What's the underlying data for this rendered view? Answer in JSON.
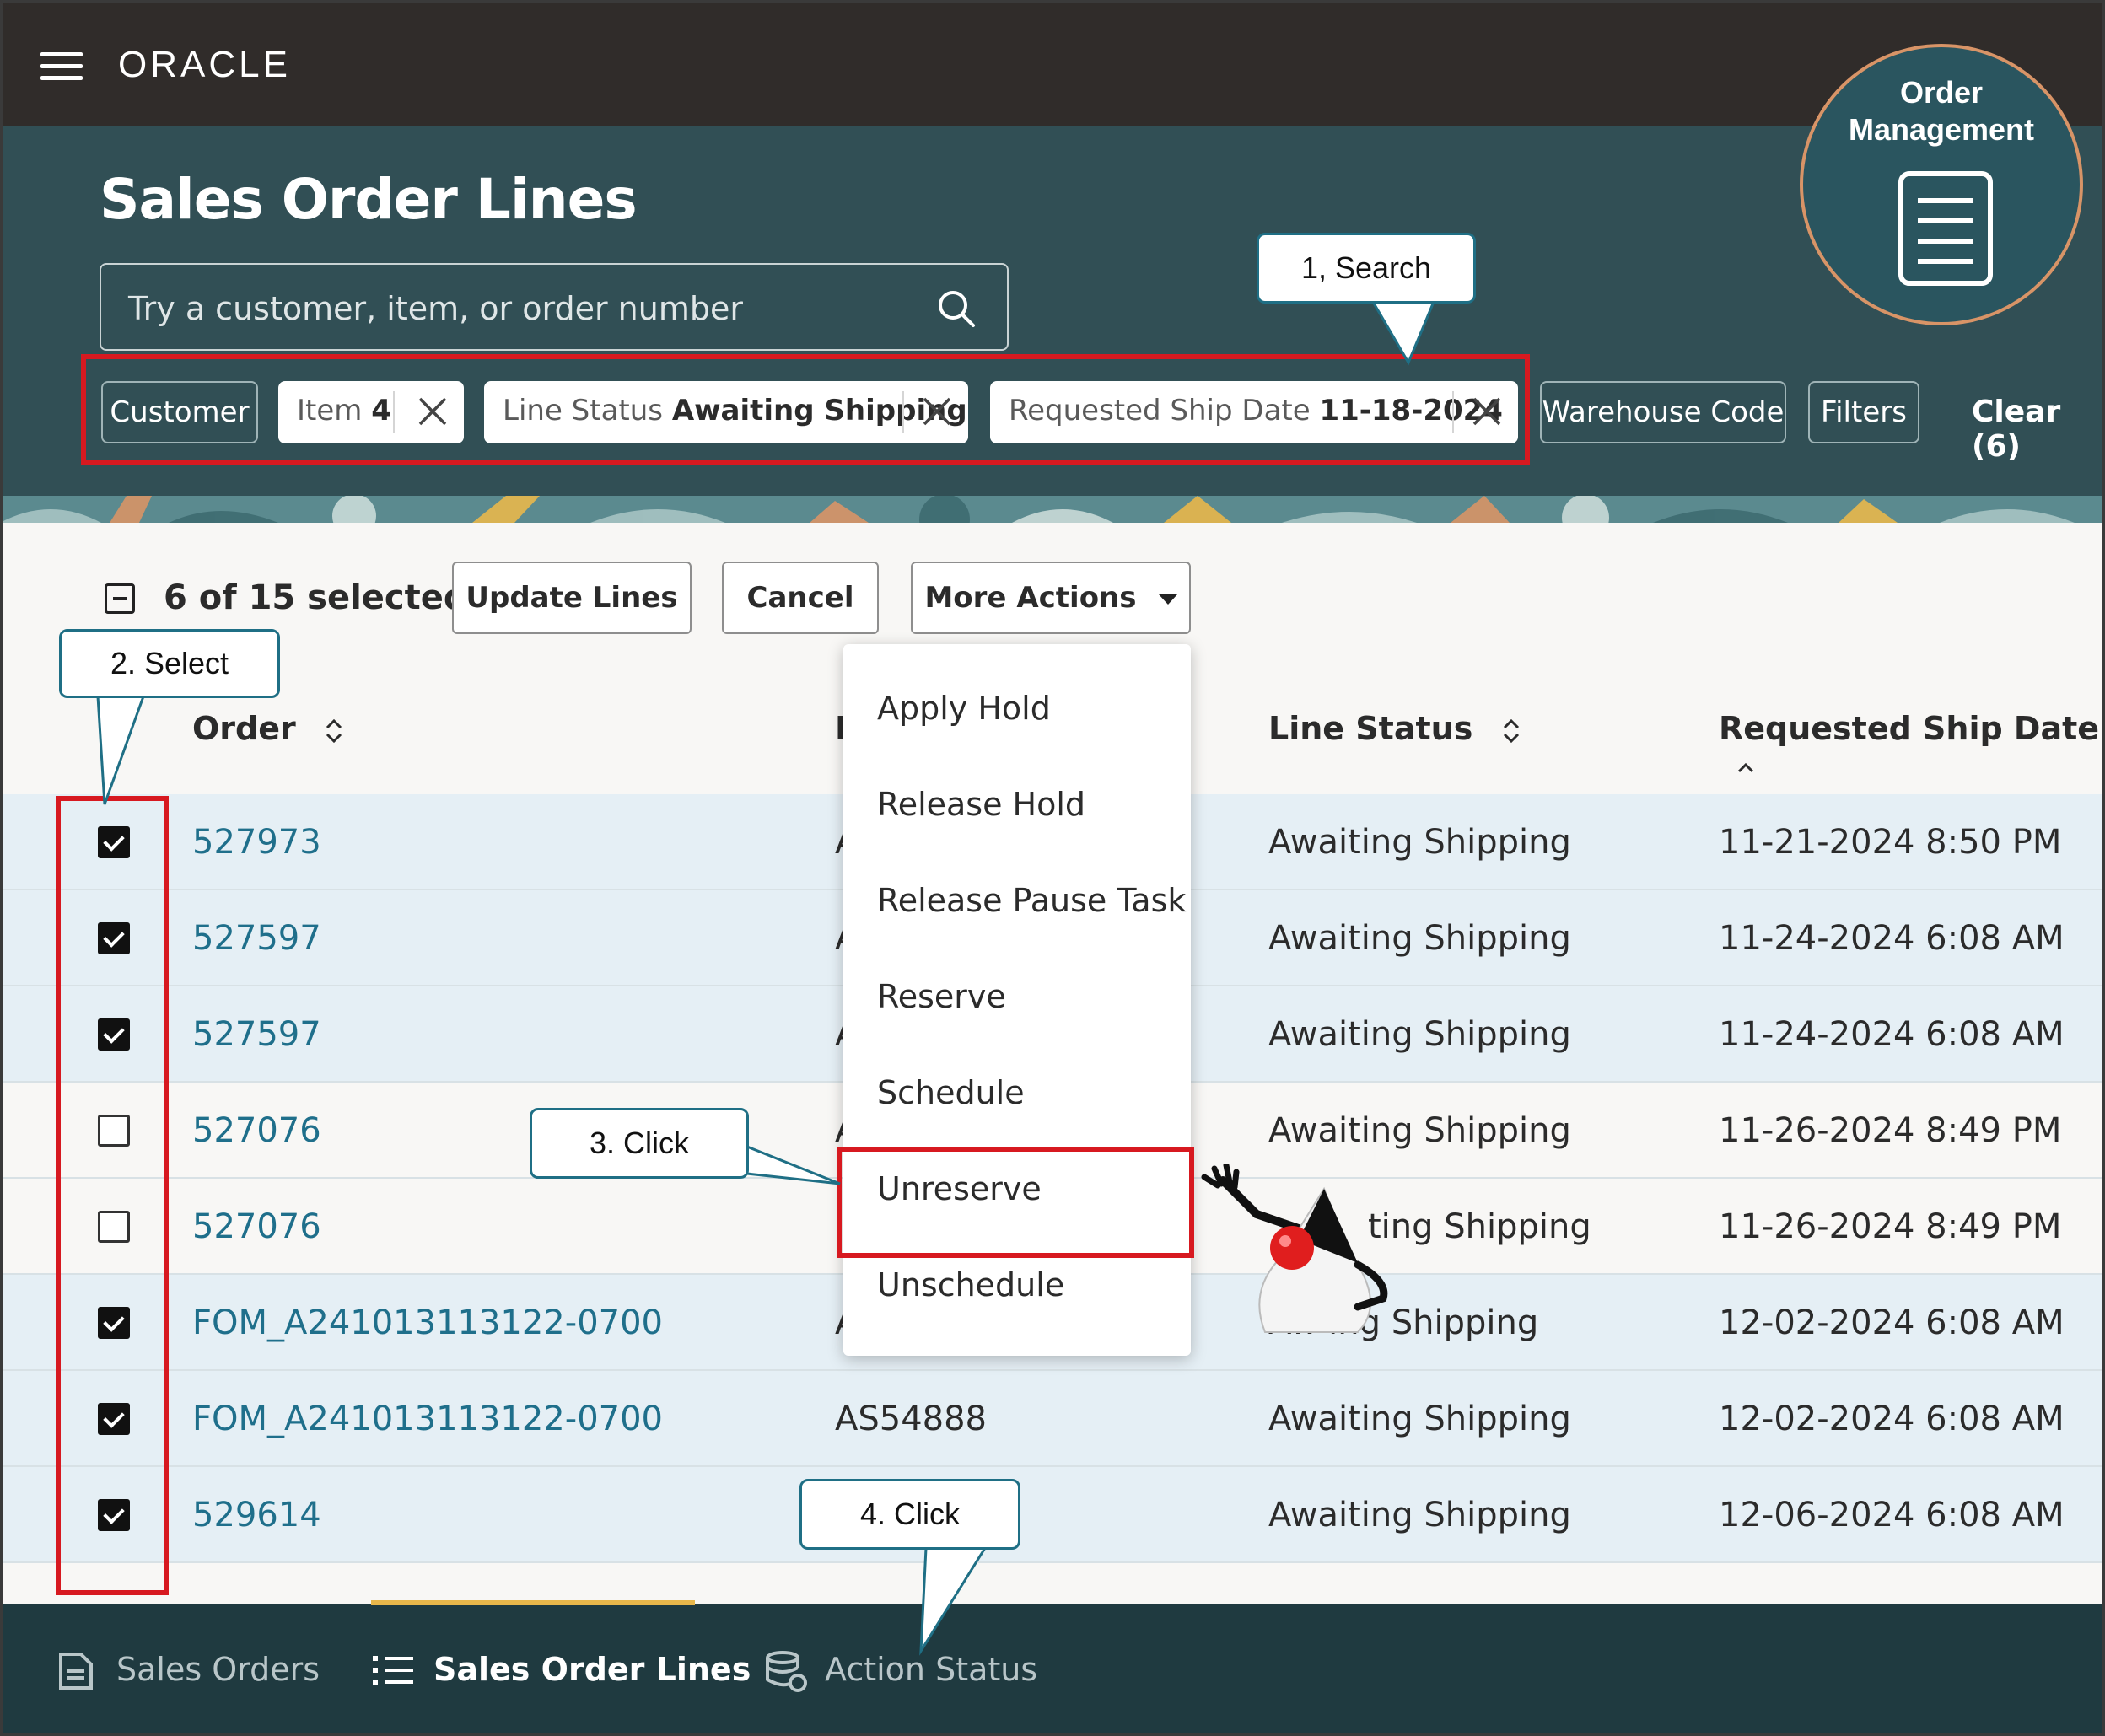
{
  "app": {
    "brand": "ORACLE",
    "badge_line1": "Order",
    "badge_line2": "Management"
  },
  "page": {
    "title": "Sales Order Lines"
  },
  "search": {
    "placeholder": "Try a customer, item, or order number"
  },
  "filters": {
    "customer": "Customer",
    "item": {
      "label": "Item",
      "value": "4"
    },
    "line_status": {
      "label": "Line Status",
      "value": "Awaiting Shipping"
    },
    "ship_date": {
      "label": "Requested Ship Date",
      "value": "11-18-2024"
    },
    "warehouse": "Warehouse Code",
    "more": "Filters",
    "clear": "Clear (6)"
  },
  "toolbar": {
    "selection": "6 of 15 selected",
    "update": "Update Lines",
    "cancel": "Cancel",
    "more_actions": "More Actions"
  },
  "table": {
    "headers": {
      "order": "Order",
      "item_partial": "I",
      "line_status": "Line Status",
      "ship_date": "Requested Ship Date"
    },
    "rows": [
      {
        "checked": true,
        "order": "527973",
        "item": "A",
        "status": "Awaiting Shipping",
        "date": "11-21-2024 8:50 PM"
      },
      {
        "checked": true,
        "order": "527597",
        "item": "A",
        "status": "Awaiting Shipping",
        "date": "11-24-2024 6:08 AM"
      },
      {
        "checked": true,
        "order": "527597",
        "item": "A",
        "status": "Awaiting Shipping",
        "date": "11-24-2024 6:08 AM"
      },
      {
        "checked": false,
        "order": "527076",
        "item": "A",
        "status": "Awaiting Shipping",
        "date": "11-26-2024 8:49 PM"
      },
      {
        "checked": false,
        "order": "527076",
        "item": "A",
        "status": "ting Shipping",
        "date": "11-26-2024 8:49 PM"
      },
      {
        "checked": true,
        "order": "FOM_A241013113122-0700",
        "item": "A",
        "status": "Aw     ing Shipping",
        "date": "12-02-2024 6:08 AM"
      },
      {
        "checked": true,
        "order": "FOM_A241013113122-0700",
        "item": "AS54888",
        "status": "Awaiting Shipping",
        "date": "12-02-2024 6:08 AM"
      },
      {
        "checked": true,
        "order": "529614",
        "item": "",
        "status": "Awaiting Shipping",
        "date": "12-06-2024 6:08 AM"
      }
    ]
  },
  "menu": {
    "items": [
      "Apply Hold",
      "Release Hold",
      "Release Pause Task",
      "Reserve",
      "Schedule",
      "Unreserve",
      "Unschedule"
    ]
  },
  "bottom_nav": {
    "sales_orders": "Sales Orders",
    "sales_order_lines": "Sales Order Lines",
    "action_status": "Action Status"
  },
  "callouts": {
    "search": "1, Search",
    "select": "2. Select",
    "click3": "3. Click",
    "click4": "4. Click"
  },
  "colors": {
    "header": "#314f55",
    "topbar": "#302c2a",
    "link": "#1f6f8b",
    "highlight": "#d71920",
    "selected_row": "#e5eff5"
  }
}
